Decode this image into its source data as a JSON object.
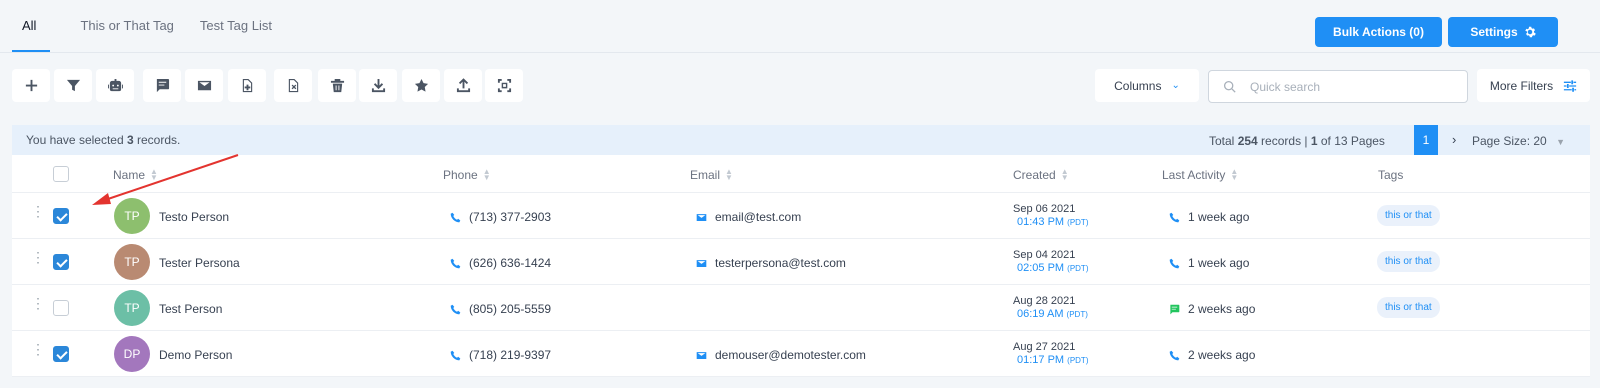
{
  "tabs": [
    "All",
    "This or That Tag",
    "Test Tag List"
  ],
  "header": {
    "bulk_actions": "Bulk Actions  (0)",
    "settings": "Settings"
  },
  "toolbar": {
    "tools": [
      "plus-icon",
      "filter-icon",
      "robot-icon",
      "message-icon",
      "envelope-icon",
      "tag-add-icon",
      "tag-remove-icon",
      "trash-icon",
      "download-icon",
      "star-icon",
      "upload-icon",
      "merge-icon"
    ],
    "columns_label": "Columns",
    "search_placeholder": "Quick search",
    "more_filters_label": "More Filters"
  },
  "selection": {
    "prefix": "You have selected ",
    "count": "3",
    "suffix": " records.",
    "total_prefix": "Total ",
    "total_records": "254",
    "total_mid": " records | ",
    "page_current": "1",
    "page_total_text": " of 13 Pages",
    "page_button": "1",
    "page_size": "Page Size: 20"
  },
  "table": {
    "headers": {
      "name": "Name",
      "phone": "Phone",
      "email": "Email",
      "created": "Created",
      "last_activity": "Last Activity",
      "tags": "Tags"
    },
    "rows": [
      {
        "initials": "TP",
        "avatar_color": "#8dbf6e",
        "name": "Testo Person",
        "phone": "(713) 377-2903",
        "email": "email@test.com",
        "created_date": "Sep 06 2021",
        "created_time": "01:43 PM",
        "tz": "(PDT)",
        "activity": "1 week ago",
        "activity_icon": "phone-icon",
        "tag": "this or that",
        "checked": true
      },
      {
        "initials": "TP",
        "avatar_color": "#b98a72",
        "name": "Tester Persona",
        "phone": "(626) 636-1424",
        "email": "testerpersona@test.com",
        "created_date": "Sep 04 2021",
        "created_time": "02:05 PM",
        "tz": "(PDT)",
        "activity": "1 week ago",
        "activity_icon": "phone-icon",
        "tag": "this or that",
        "checked": true
      },
      {
        "initials": "TP",
        "avatar_color": "#6cbfa6",
        "name": "Test Person",
        "phone": "(805) 205-5559",
        "email": "",
        "created_date": "Aug 28 2021",
        "created_time": "06:19 AM",
        "tz": "(PDT)",
        "activity": "2 weeks ago",
        "activity_icon": "sms-icon",
        "tag": "this or that",
        "checked": false
      },
      {
        "initials": "DP",
        "avatar_color": "#a377bd",
        "name": "Demo Person",
        "phone": "(718) 219-9397",
        "email": "demouser@demotester.com",
        "created_date": "Aug 27 2021",
        "created_time": "01:17 PM",
        "tz": "(PDT)",
        "activity": "2 weeks ago",
        "activity_icon": "phone-icon",
        "tag": "",
        "checked": true
      }
    ]
  }
}
